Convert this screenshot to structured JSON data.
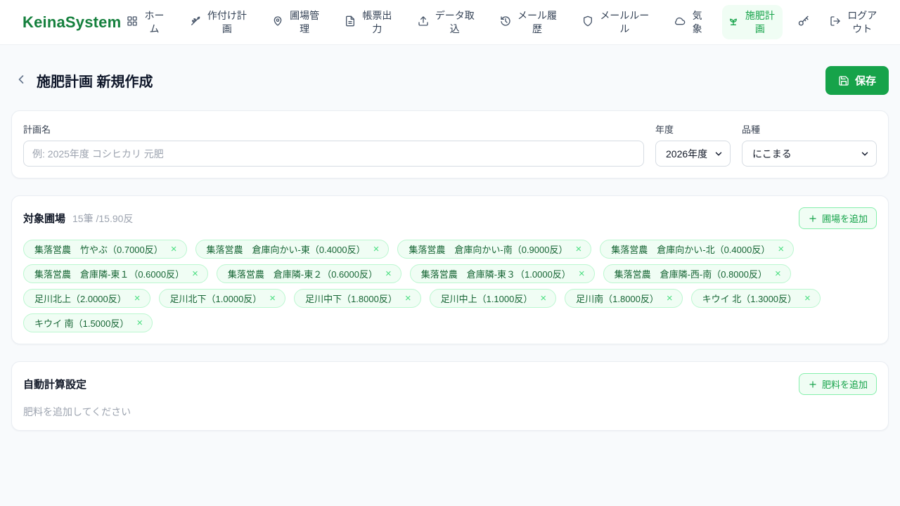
{
  "brand": "KeinaSystem",
  "colors": {
    "accent_green": "#16a34a",
    "brand_green": "#15803d",
    "tag_bg": "#f0fdf4",
    "tag_border": "#bbf7d0",
    "tag_text": "#166534",
    "page_bg": "#f8fafc"
  },
  "icons": {
    "close": "×"
  },
  "nav": {
    "items": [
      {
        "label": "ホーム",
        "icon": "grid-icon",
        "active": false
      },
      {
        "label": "作付け計画",
        "icon": "wheat-icon",
        "active": false
      },
      {
        "label": "圃場管理",
        "icon": "map-pin-icon",
        "active": false
      },
      {
        "label": "帳票出力",
        "icon": "file-text-icon",
        "active": false
      },
      {
        "label": "データ取込",
        "icon": "upload-icon",
        "active": false
      },
      {
        "label": "メール履歴",
        "icon": "history-icon",
        "active": false
      },
      {
        "label": "メールルール",
        "icon": "shield-icon",
        "active": false
      },
      {
        "label": "気象",
        "icon": "cloud-icon",
        "active": false
      },
      {
        "label": "施肥計画",
        "icon": "sprout-icon",
        "active": true
      },
      {
        "label": "",
        "icon": "key-icon",
        "active": false
      },
      {
        "label": "ログアウト",
        "icon": "logout-icon",
        "active": false
      }
    ]
  },
  "page": {
    "title": "施肥計画 新規作成",
    "save_label": "保存"
  },
  "form": {
    "plan_name": {
      "label": "計画名",
      "placeholder": "例: 2025年度 コシヒカリ 元肥",
      "value": ""
    },
    "year": {
      "label": "年度",
      "value": "2026年度"
    },
    "variety": {
      "label": "品種",
      "value": "にこまる"
    }
  },
  "fields_section": {
    "title": "対象圃場",
    "summary": "15筆 /15.90反",
    "add_button": "圃場を追加",
    "tags": [
      {
        "label": "集落営農　竹やぶ（0.7000反）"
      },
      {
        "label": "集落営農　倉庫向かい-東（0.4000反）"
      },
      {
        "label": "集落営農　倉庫向かい-南（0.9000反）"
      },
      {
        "label": "集落営農　倉庫向かい-北（0.4000反）"
      },
      {
        "label": "集落営農　倉庫隣-東１（0.6000反）"
      },
      {
        "label": "集落営農　倉庫隣-東２（0.6000反）"
      },
      {
        "label": "集落営農　倉庫隣-東３（1.0000反）"
      },
      {
        "label": "集落営農　倉庫隣-西-南（0.8000反）"
      },
      {
        "label": "足川北上（2.0000反）"
      },
      {
        "label": "足川北下（1.0000反）"
      },
      {
        "label": "足川中下（1.8000反）"
      },
      {
        "label": "足川中上（1.1000反）"
      },
      {
        "label": "足川南（1.8000反）"
      },
      {
        "label": "キウイ 北（1.3000反）"
      },
      {
        "label": "キウイ 南（1.5000反）"
      }
    ]
  },
  "auto_calc": {
    "title": "自動計算設定",
    "add_button": "肥料を追加",
    "empty_text": "肥料を追加してください"
  }
}
